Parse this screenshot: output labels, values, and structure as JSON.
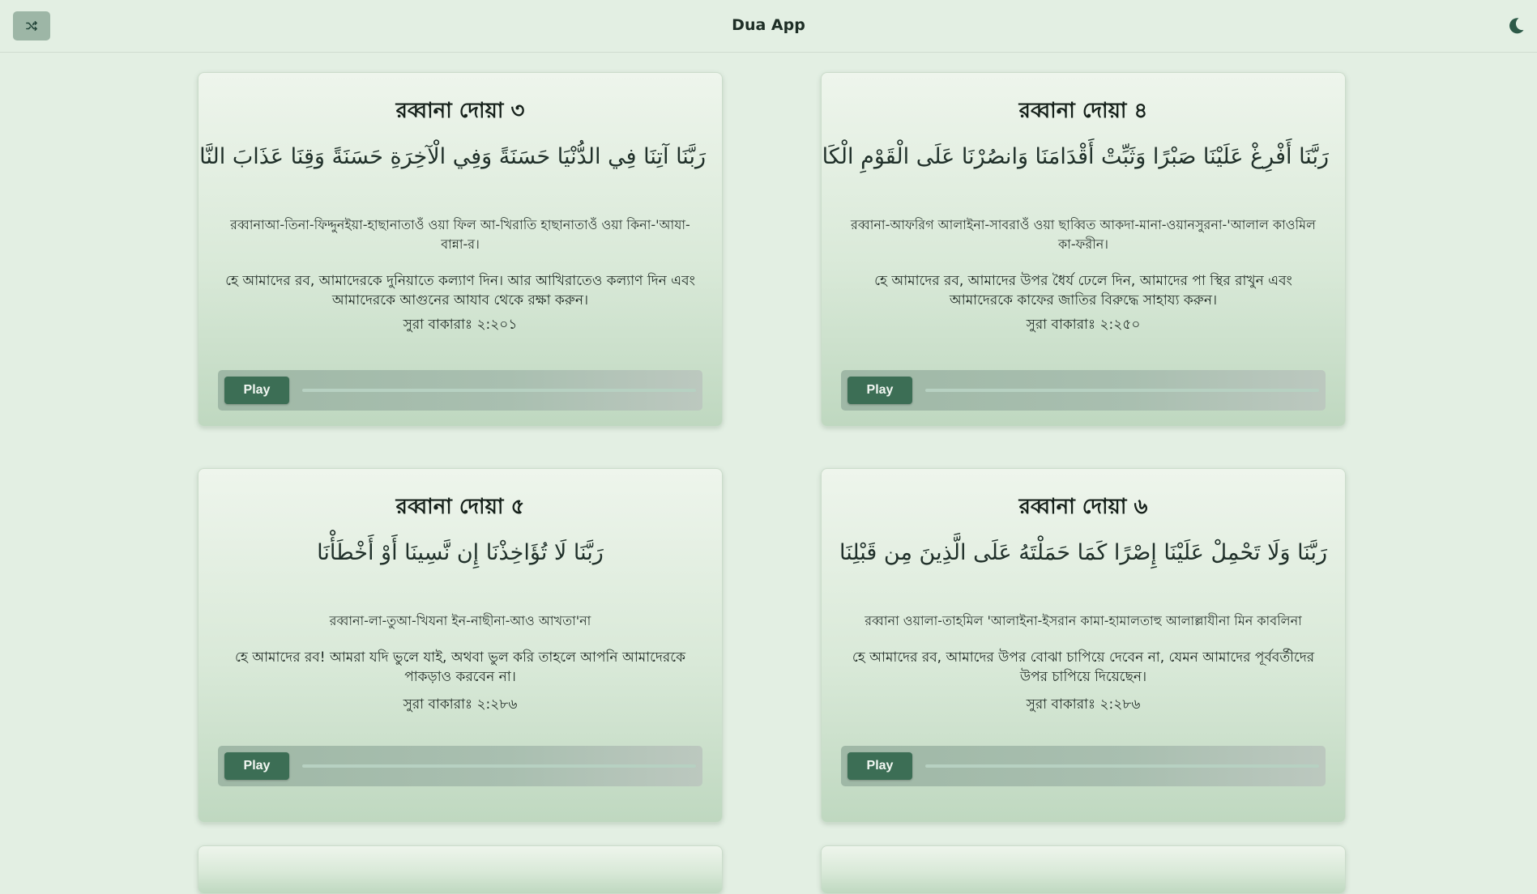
{
  "header": {
    "title": "Dua App",
    "shuffle_icon": "shuffle-icon",
    "theme_icon": "moon-icon"
  },
  "colors": {
    "background": "#e3efe3",
    "accent": "#3c6e55",
    "shuffle_button": "#9db6a6"
  },
  "cards": [
    {
      "title": "রব্বানা দোয়া ৩",
      "arabic": "رَبَّنَا آتِنَا فِي الدُّنْيَا حَسَنَةً وَفِي الْآخِرَةِ حَسَنَةً وَقِنَا عَذَابَ النَّارِ",
      "transliteration": "রব্বানাআ-তিনা-ফিদ্দুনইয়া-হাছানাতাওঁ ওয়া ফিল আ-খিরাতি হাছানাতাওঁ ওয়া কিনা-'আযা-বান্না-র।",
      "translation": "হে আমাদের রব, আমাদেরকে দুনিয়াতে কল্যাণ দিন। আর আখিরাতেও কল্যাণ দিন এবং আমাদেরকে আগুনের আযাব থেকে রক্ষা করুন।",
      "reference": "সুরা বাকারাঃ ২:২০১",
      "play_label": "Play",
      "progress": 0
    },
    {
      "title": "রব্বানা দোয়া ৪",
      "arabic": "رَبَّنَا أَفْرِغْ عَلَيْنَا صَبْرًا وَثَبِّتْ أَقْدَامَنَا وَانصُرْنَا عَلَى الْقَوْمِ الْكَافِرِينَ",
      "transliteration": "রব্বানা-আফরিগ আলাইনা-সাবরাওঁ ওয়া ছাব্বিত আকদা-মানা-ওয়ানসুরনা-'আলাল কাওমিল কা-ফরীন।",
      "translation": "হে আমাদের রব, আমাদের উপর ধৈর্য ঢেলে দিন, আমাদের পা স্থির রাখুন এবং আমাদেরকে কাফের জাতির বিরুদ্ধে সাহায্য করুন।",
      "reference": "সুরা বাকারাঃ ২:২৫০",
      "play_label": "Play",
      "progress": 0
    },
    {
      "title": "রব্বানা দোয়া ৫",
      "arabic": "رَبَّنَا لَا تُؤَاخِذْنَا إِن نَّسِينَا أَوْ أَخْطَأْنَا",
      "transliteration": "রব্বানা-লা-তুআ-খিযনা ইন-নাছীনা-আও আখতা'না",
      "translation": "হে আমাদের রব! আমরা যদি ভুলে যাই, অথবা ভুল করি তাহলে আপনি আমাদেরকে পাকড়াও করবেন না।",
      "reference": "সুরা বাকারাঃ ২:২৮৬",
      "play_label": "Play",
      "progress": 0
    },
    {
      "title": "রব্বানা দোয়া ৬",
      "arabic": "رَبَّنَا وَلَا تَحْمِلْ عَلَيْنَا إِصْرًا كَمَا حَمَلْتَهُ عَلَى الَّذِينَ مِن قَبْلِنَا",
      "transliteration": "রব্বানা ওয়ালা-তাহমিল 'আলাইনা-ইসরান কামা-হামালতাহু আলাল্লাযীনা মিন কাবলিনা",
      "translation": "হে আমাদের রব, আমাদের উপর বোঝা চাপিয়ে দেবেন না, যেমন আমাদের পূর্ববর্তীদের উপর চাপিয়ে দিয়েছেন।",
      "reference": "সুরা বাকারাঃ ২:২৮৬",
      "play_label": "Play",
      "progress": 0
    }
  ]
}
